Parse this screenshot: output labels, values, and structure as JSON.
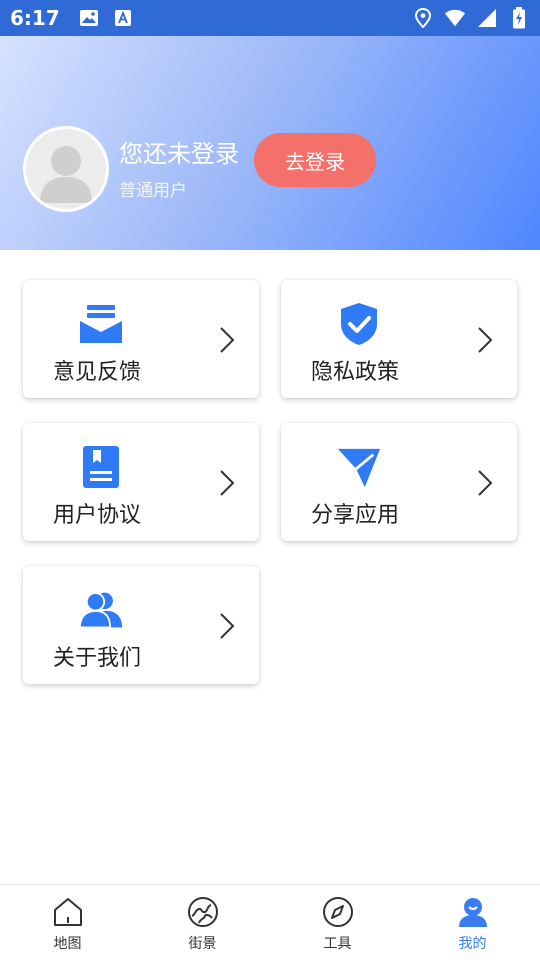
{
  "status_bar": {
    "time": "6:17",
    "left_icons": [
      "image-icon",
      "font-icon"
    ],
    "right_icons": [
      "location-icon",
      "wifi-icon",
      "signal-icon",
      "battery-icon"
    ],
    "bg_color": "#2f6ad6"
  },
  "profile": {
    "title": "您还未登录",
    "subtitle": "普通用户",
    "login_button": "去登录",
    "login_button_color": "#f4706a"
  },
  "menu": {
    "items": [
      {
        "label": "意见反馈",
        "icon": "mail-icon"
      },
      {
        "label": "隐私政策",
        "icon": "shield-icon"
      },
      {
        "label": "用户协议",
        "icon": "book-icon"
      },
      {
        "label": "分享应用",
        "icon": "send-icon"
      },
      {
        "label": "关于我们",
        "icon": "users-icon"
      }
    ],
    "accent_color": "#2f7bf5"
  },
  "bottom_nav": {
    "items": [
      {
        "label": "地图",
        "icon": "home-icon",
        "active": false
      },
      {
        "label": "街景",
        "icon": "globe-icon",
        "active": false
      },
      {
        "label": "工具",
        "icon": "compass-icon",
        "active": false
      },
      {
        "label": "我的",
        "icon": "profile-icon",
        "active": true
      }
    ],
    "active_color": "#3b7df0"
  }
}
